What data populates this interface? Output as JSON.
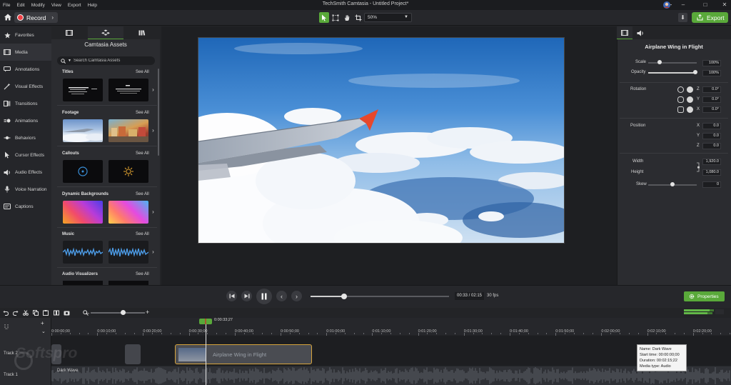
{
  "menu": [
    "File",
    "Edit",
    "Modify",
    "View",
    "Export",
    "Help"
  ],
  "window_title": "TechSmith Camtasia - Untitled Project*",
  "toolbar": {
    "record_label": "Record",
    "zoom_value": "50%",
    "export_label": "Export"
  },
  "nav": [
    {
      "label": "Favorites",
      "icon": "star-icon"
    },
    {
      "label": "Media",
      "icon": "film-icon"
    },
    {
      "label": "Annotations",
      "icon": "annotation-icon"
    },
    {
      "label": "Visual Effects",
      "icon": "visual-effects-icon"
    },
    {
      "label": "Transitions",
      "icon": "transition-icon"
    },
    {
      "label": "Animations",
      "icon": "animation-icon"
    },
    {
      "label": "Behaviors",
      "icon": "behavior-icon"
    },
    {
      "label": "Cursor Effects",
      "icon": "cursor-icon"
    },
    {
      "label": "Audio Effects",
      "icon": "speaker-icon"
    },
    {
      "label": "Voice Narration",
      "icon": "microphone-icon"
    },
    {
      "label": "Captions",
      "icon": "captions-icon"
    }
  ],
  "assets": {
    "title": "Camtasia Assets",
    "search_placeholder": "Search Camtasia Assets",
    "see_all": "See All",
    "categories": [
      "Titles",
      "Footage",
      "Callouts",
      "Dynamic Backgrounds",
      "Music",
      "Audio Visualizers"
    ]
  },
  "properties": {
    "title": "Airplane Wing in Flight",
    "scale_label": "Scale",
    "scale_value": "100%",
    "opacity_label": "Opacity",
    "opacity_value": "100%",
    "rotation_label": "Rotation",
    "rot_z": "0.0°",
    "rot_y": "0.0°",
    "rot_x": "0.0°",
    "position_label": "Position",
    "pos_x": "0.0",
    "pos_y": "0.0",
    "pos_z": "0.0",
    "width_label": "Width",
    "width_value": "1,920.0",
    "height_label": "Height",
    "height_value": "1,080.0",
    "skew_label": "Skew",
    "skew_value": "0",
    "axis_x": "X",
    "axis_y": "Y",
    "axis_z": "Z"
  },
  "playback": {
    "time": "00:33 / 02:15",
    "fps": "30 fps",
    "properties_label": "Properties",
    "progress": 0.244
  },
  "timeline": {
    "playhead_time": "0:00:33;27",
    "ruler": [
      "0:00:00;00",
      "0:00:10;00",
      "0:00:20;00",
      "0:00:30;00",
      "0:00:40;00",
      "0:00:50;00",
      "0:01:00;00",
      "0:01:10;00",
      "0:01:20;00",
      "0:01:30;00",
      "0:01:40;00",
      "0:01:50;00",
      "0:02:00;00",
      "0:02:10;00",
      "0:02:20;00"
    ],
    "track2_label": "Track 2",
    "track1_label": "Track 1",
    "clip_name": "Airplane Wing in Flight",
    "audio_clip_name": "Dark Wave"
  },
  "tooltip": {
    "name": "Name: Dark Wave",
    "start": "Start time: 00:00:00;00",
    "duration": "Duration: 00:02:15;22",
    "type": "Media type: Audio"
  },
  "watermark": "Softspro",
  "colors": {
    "accent": "#59a93a",
    "record": "#ef3f45",
    "clip_border": "#d7a43c"
  }
}
